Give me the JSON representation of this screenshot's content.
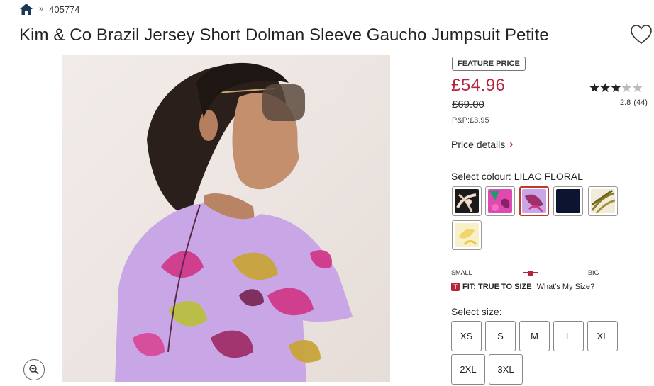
{
  "breadcrumb": {
    "separator": "»",
    "code": "405774"
  },
  "product": {
    "title": "Kim & Co Brazil Jersey Short Dolman Sleeve Gaucho Jumpsuit Petite",
    "badge": "FEATURE PRICE",
    "price": "£54.96",
    "was_price": "£69.00",
    "postage": "P&P:£3.95",
    "rating": {
      "stars_filled": 3,
      "stars_total": 5,
      "score": "2.8",
      "count": "(44)"
    },
    "price_details": "Price details"
  },
  "colours": {
    "label": "Select colour: LILAC FLORAL",
    "swatches": [
      {
        "name": "black-white-floral",
        "selected": false
      },
      {
        "name": "pink-green-floral",
        "selected": false
      },
      {
        "name": "lilac-floral",
        "selected": true
      },
      {
        "name": "navy",
        "selected": false
      },
      {
        "name": "olive-stripe",
        "selected": false
      },
      {
        "name": "yellow-floral",
        "selected": false
      }
    ]
  },
  "fit": {
    "small_label": "SMALL",
    "big_label": "BIG",
    "position": 0.5,
    "logo": "T",
    "text": "FIT: TRUE TO SIZE",
    "link": "What's My Size?"
  },
  "sizes": {
    "label": "Select size:",
    "options": [
      "XS",
      "S",
      "M",
      "L",
      "XL",
      "2XL",
      "3XL"
    ]
  },
  "colors": {
    "accent": "#b5243c",
    "border": "#888888"
  },
  "icons": [
    "home-icon",
    "heart-icon",
    "zoom-icon",
    "chevron-right-icon"
  ]
}
